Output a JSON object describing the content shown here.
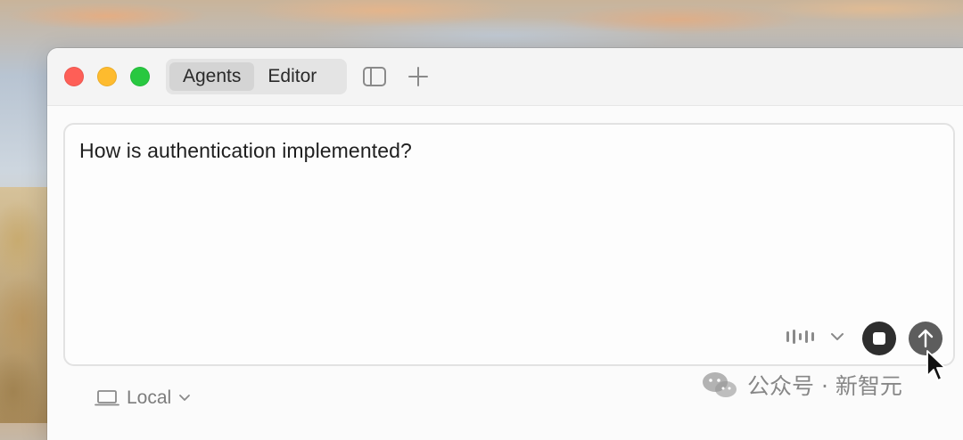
{
  "window": {
    "tabs": [
      {
        "label": "Agents",
        "active": true
      },
      {
        "label": "Editor",
        "active": false
      }
    ]
  },
  "prompt": {
    "text": "How is authentication implemented?"
  },
  "footer": {
    "location_label": "Local"
  },
  "watermark": {
    "text": "公众号 · 新智元"
  },
  "icons": {
    "sidebar": "sidebar-toggle-icon",
    "new": "plus-icon",
    "voice": "audio-bars-icon",
    "dropdown": "chevron-down-icon",
    "stop": "stop-icon",
    "send": "arrow-up-icon",
    "location": "laptop-icon",
    "watermark": "wechat-icon"
  },
  "colors": {
    "close": "#fe5f57",
    "minimize": "#febb2e",
    "maximize": "#28c840",
    "stop_button": "#2e2e2e",
    "send_button": "#5d5d5d"
  }
}
